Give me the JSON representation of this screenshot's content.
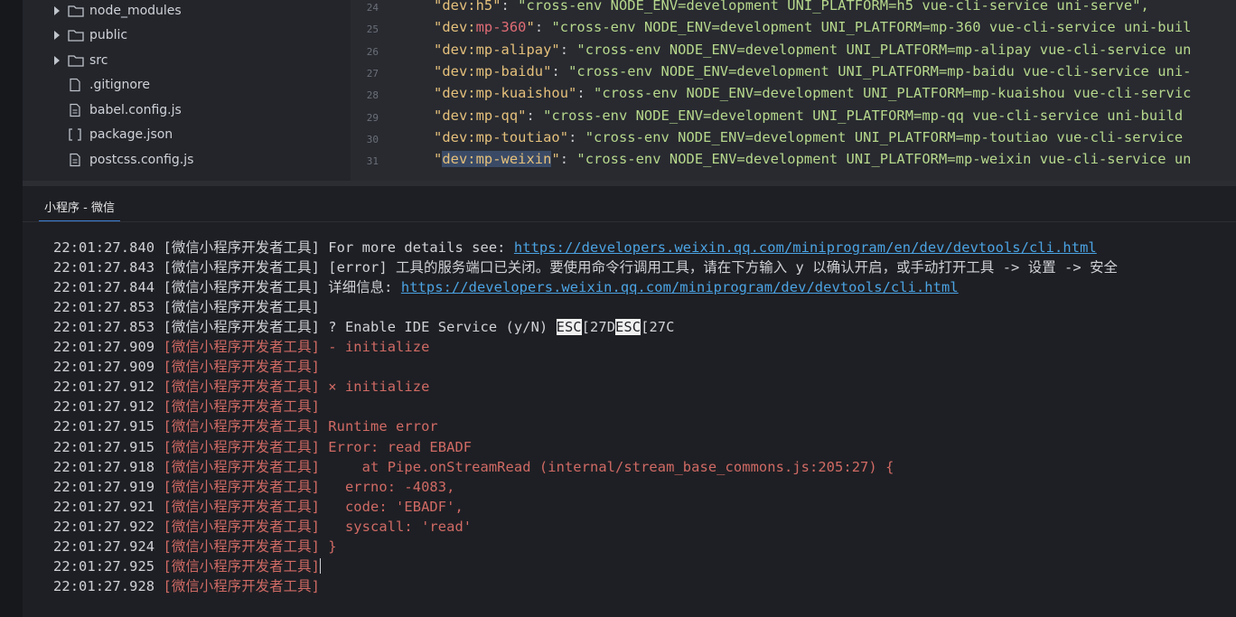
{
  "explorer": {
    "items": [
      {
        "type": "folder",
        "name": "node_modules"
      },
      {
        "type": "folder",
        "name": "public"
      },
      {
        "type": "folder",
        "name": "src"
      },
      {
        "type": "file",
        "name": ".gitignore"
      },
      {
        "type": "js",
        "name": "babel.config.js"
      },
      {
        "type": "json",
        "name": "package.json"
      },
      {
        "type": "js",
        "name": "postcss.config.js"
      }
    ]
  },
  "editor": {
    "lines": [
      {
        "num": "24",
        "key": "\"dev:h5\"",
        "plat": "",
        "rest": ": ",
        "val": "\"cross-env NODE_ENV=development UNI_PLATFORM=h5 vue-cli-service uni-serve\","
      },
      {
        "num": "25",
        "key": "\"dev:",
        "plat": "mp-360",
        "keyend": "\"",
        "rest": ": ",
        "val": "\"cross-env NODE_ENV=development UNI_PLATFORM=mp-360 vue-cli-service uni-buil"
      },
      {
        "num": "26",
        "key": "\"dev:mp-alipay\"",
        "rest": ": ",
        "val": "\"cross-env NODE_ENV=development UNI_PLATFORM=mp-alipay vue-cli-service un"
      },
      {
        "num": "27",
        "key": "\"dev:mp-baidu\"",
        "rest": ": ",
        "val": "\"cross-env NODE_ENV=development UNI_PLATFORM=mp-baidu vue-cli-service uni-"
      },
      {
        "num": "28",
        "key": "\"dev:mp-kuaishou\"",
        "rest": ": ",
        "val": "\"cross-env NODE_ENV=development UNI_PLATFORM=mp-kuaishou vue-cli-servic"
      },
      {
        "num": "29",
        "key": "\"dev:mp-qq\"",
        "rest": ": ",
        "val": "\"cross-env NODE_ENV=development UNI_PLATFORM=mp-qq vue-cli-service uni-build"
      },
      {
        "num": "30",
        "key": "\"dev:mp-toutiao\"",
        "rest": ": ",
        "val": "\"cross-env NODE_ENV=development UNI_PLATFORM=mp-toutiao vue-cli-service"
      },
      {
        "num": "31",
        "key": "\"",
        "selected": "dev:mp-weixin",
        "keyend": "\"",
        "rest": ": ",
        "val": "\"cross-env NODE_ENV=development UNI_PLATFORM=mp-weixin vue-cli-service un"
      }
    ]
  },
  "panel": {
    "tab_label": "小程序 - 微信",
    "log": [
      {
        "ts": "22:01:27.840",
        "tag": "[微信小程序开发者工具]",
        "msg": " For more details see: ",
        "link": "https://developers.weixin.qq.com/miniprogram/en/dev/devtools/cli.html",
        "red": false
      },
      {
        "ts": "22:01:27.843",
        "tag": "[微信小程序开发者工具]",
        "msg": " [error] 工具的服务端口已关闭。要使用命令行调用工具，请在下方输入 y 以确认开启，或手动打开工具 -> 设置 -> 安全",
        "red": false
      },
      {
        "ts": "22:01:27.844",
        "tag": "[微信小程序开发者工具]",
        "msg": " 详细信息: ",
        "link": "https://developers.weixin.qq.com/miniprogram/dev/devtools/cli.html",
        "red": false
      },
      {
        "ts": "22:01:27.853",
        "tag": "[微信小程序开发者工具]",
        "msg": "",
        "red": false
      },
      {
        "ts": "22:01:27.853",
        "tag": "[微信小程序开发者工具]",
        "msg": " ? Enable IDE Service (y/N) ",
        "esc1": "ESC",
        "mid": "[27D",
        "esc2": "ESC",
        "end": "[27C",
        "red": false
      },
      {
        "ts": "22:01:27.909",
        "tag": "[微信小程序开发者工具]",
        "msg": " - initialize",
        "red": true
      },
      {
        "ts": "22:01:27.909",
        "tag": "[微信小程序开发者工具]",
        "msg": "",
        "red": true
      },
      {
        "ts": "22:01:27.912",
        "tag": "[微信小程序开发者工具]",
        "msg": " × initialize",
        "red": true
      },
      {
        "ts": "22:01:27.912",
        "tag": "[微信小程序开发者工具]",
        "msg": "",
        "red": true
      },
      {
        "ts": "22:01:27.915",
        "tag": "[微信小程序开发者工具]",
        "msg": " Runtime error",
        "red": true
      },
      {
        "ts": "22:01:27.915",
        "tag": "[微信小程序开发者工具]",
        "msg": " Error: read EBADF",
        "red": true
      },
      {
        "ts": "22:01:27.918",
        "tag": "[微信小程序开发者工具]",
        "msg": "     at Pipe.onStreamRead (internal/stream_base_commons.js:205:27) {",
        "red": true
      },
      {
        "ts": "22:01:27.919",
        "tag": "[微信小程序开发者工具]",
        "msg": "   errno: -4083,",
        "red": true
      },
      {
        "ts": "22:01:27.921",
        "tag": "[微信小程序开发者工具]",
        "msg": "   code: 'EBADF',",
        "red": true
      },
      {
        "ts": "22:01:27.922",
        "tag": "[微信小程序开发者工具]",
        "msg": "   syscall: 'read'",
        "red": true
      },
      {
        "ts": "22:01:27.924",
        "tag": "[微信小程序开发者工具]",
        "msg": " }",
        "red": true
      },
      {
        "ts": "22:01:27.925",
        "tag": "[微信小程序开发者工具]",
        "msg": "",
        "red": true,
        "cursor": true
      },
      {
        "ts": "22:01:27.928",
        "tag": "[微信小程序开发者工具]",
        "msg": "",
        "red": true
      }
    ]
  }
}
